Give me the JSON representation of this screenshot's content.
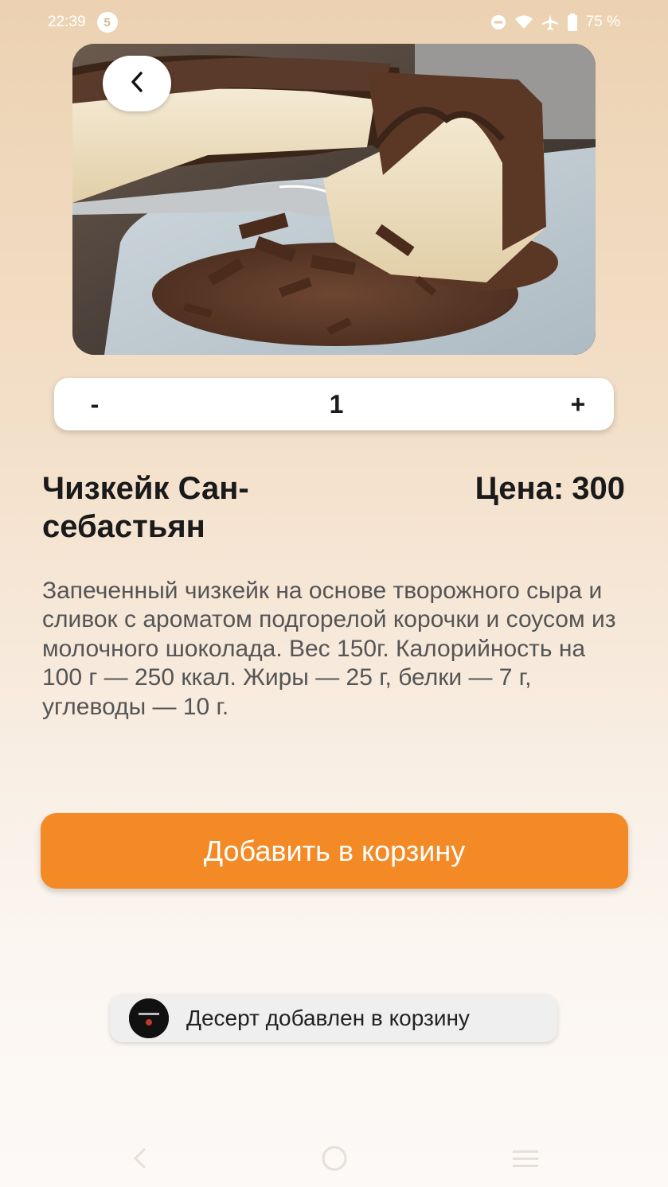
{
  "status_bar": {
    "time": "22:39",
    "notification_count": "5",
    "battery": "75 %"
  },
  "icons": {
    "back": "chevron-left-icon",
    "dnd": "do-not-disturb-icon",
    "wifi": "wifi-icon",
    "airplane": "airplane-icon",
    "battery": "battery-icon"
  },
  "quantity": {
    "minus_label": "-",
    "value": "1",
    "plus_label": "+"
  },
  "product": {
    "title": "Чизкейк Сан-себастьян",
    "price_label": "Цена:",
    "price_value": "300",
    "description": "Запеченный чизкейк на основе творожного сыра и сливок с ароматом подгорелой корочки и соусом из молочного шоколада. Вес 150г. Калорийность на 100 г  — 250 ккал. Жиры — 25 г, белки — 7 г, углеводы — 10 г."
  },
  "add_to_cart_label": "Добавить в корзину",
  "toast": {
    "message": "Десерт добавлен в корзину"
  },
  "colors": {
    "accent": "#f48a26",
    "background_top": "#ecd2b2",
    "background_bottom": "#fcf9f6"
  }
}
